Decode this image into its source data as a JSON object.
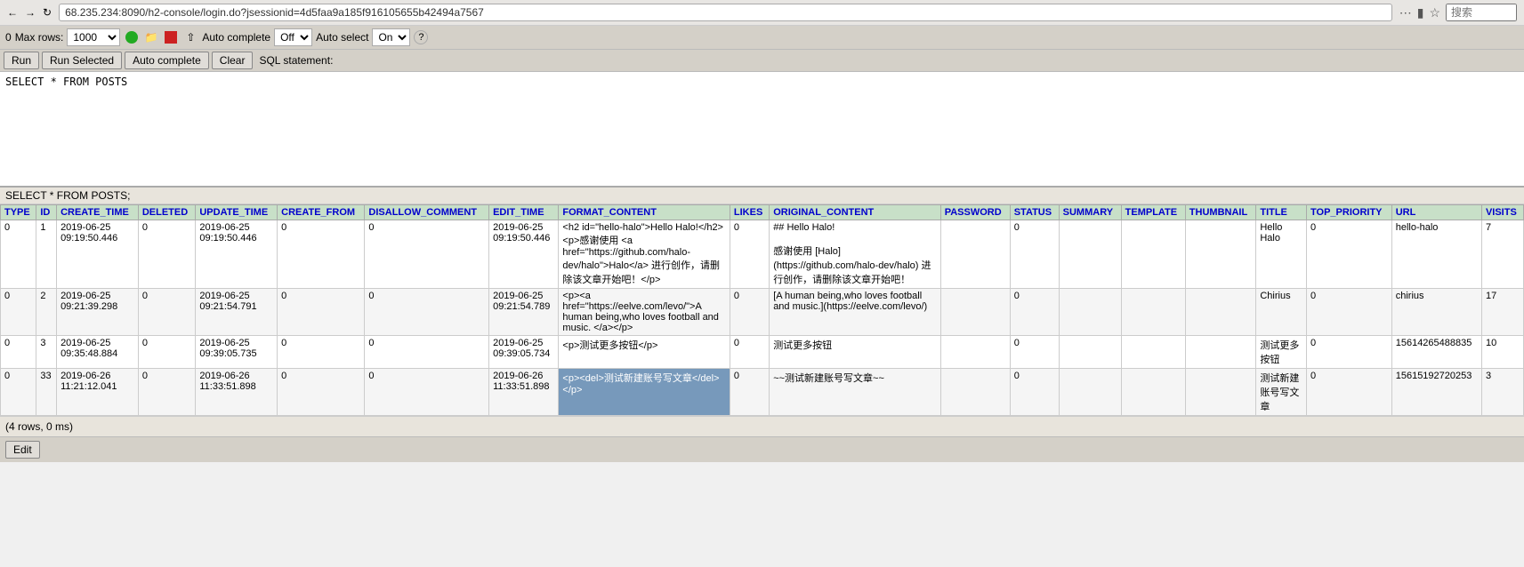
{
  "browser": {
    "url": "68.235.234:8090/h2-console/login.do?jsessionid=4d5faa9a185f916105655b42494a7567",
    "search_placeholder": "搜索"
  },
  "toolbar": {
    "max_rows_label": "Max rows:",
    "max_rows_value": "1000",
    "auto_complete_label": "Auto complete",
    "auto_complete_value": "Off",
    "auto_select_label": "Auto select",
    "auto_select_value": "On"
  },
  "buttons": {
    "run": "Run",
    "run_selected": "Run Selected",
    "auto_complete": "Auto complete",
    "clear": "Clear",
    "sql_statement": "SQL statement:",
    "edit": "Edit"
  },
  "sql_text": "SELECT * FROM POSTS",
  "query_history": "SELECT * FROM POSTS;",
  "row_info": "(4 rows, 0 ms)",
  "columns": [
    "TYPE",
    "ID",
    "CREATE_TIME",
    "DELETED",
    "UPDATE_TIME",
    "CREATE_FROM",
    "DISALLOW_COMMENT",
    "EDIT_TIME",
    "FORMAT_CONTENT",
    "LIKES",
    "ORIGINAL_CONTENT",
    "PASSWORD",
    "STATUS",
    "SUMMARY",
    "TEMPLATE",
    "THUMBNAIL",
    "TITLE",
    "TOP_PRIORITY",
    "URL",
    "VISITS"
  ],
  "rows": [
    {
      "TYPE": "0",
      "ID": "1",
      "CREATE_TIME": "2019-06-25\n09:19:50.446",
      "DELETED": "0",
      "UPDATE_TIME": "2019-06-25\n09:19:50.446",
      "CREATE_FROM": "0",
      "DISALLOW_COMMENT": "0",
      "EDIT_TIME": "2019-06-25\n09:19:50.446",
      "FORMAT_CONTENT": "<h2 id=\"hello-halo\">Hello Halo!</h2>\n<p>感谢使用 <a href=\"https://github.com/halo-dev/halo\">Halo</a> 进行创作，请删除该文章开始吧！</p>",
      "LIKES": "0",
      "ORIGINAL_CONTENT": "## Hello Halo!\n\n感谢使用 [Halo](https://github.com/halo-dev/halo) 进行创作，请删除该文章开始吧！",
      "PASSWORD": "",
      "STATUS": "0",
      "SUMMARY": "",
      "TEMPLATE": "",
      "THUMBNAIL": "",
      "TITLE": "Hello\nHalo",
      "TOP_PRIORITY": "0",
      "URL": "hello-halo",
      "VISITS": "7"
    },
    {
      "TYPE": "0",
      "ID": "2",
      "CREATE_TIME": "2019-06-25\n09:21:39.298",
      "DELETED": "0",
      "UPDATE_TIME": "2019-06-25\n09:21:54.791",
      "CREATE_FROM": "0",
      "DISALLOW_COMMENT": "0",
      "EDIT_TIME": "2019-06-25\n09:21:54.789",
      "FORMAT_CONTENT": "<p><a href=\"https://eelve.com/levo/\">A human being,who loves football and music. </a></p>",
      "LIKES": "0",
      "ORIGINAL_CONTENT": "[A human being,who loves football and music.](https://eelve.com/levo/)",
      "PASSWORD": "",
      "STATUS": "0",
      "SUMMARY": "",
      "TEMPLATE": "",
      "THUMBNAIL": "",
      "TITLE": "Chirius",
      "TOP_PRIORITY": "0",
      "URL": "chirius",
      "VISITS": "17"
    },
    {
      "TYPE": "0",
      "ID": "3",
      "CREATE_TIME": "2019-06-25\n09:35:48.884",
      "DELETED": "0",
      "UPDATE_TIME": "2019-06-25\n09:39:05.735",
      "CREATE_FROM": "0",
      "DISALLOW_COMMENT": "0",
      "EDIT_TIME": "2019-06-25\n09:39:05.734",
      "FORMAT_CONTENT": "<p>测试更多按钮</p>",
      "LIKES": "0",
      "ORIGINAL_CONTENT": "测试更多按钮",
      "PASSWORD": "",
      "STATUS": "0",
      "SUMMARY": "",
      "TEMPLATE": "",
      "THUMBNAIL": "",
      "TITLE": "测试更多\n按钮",
      "TOP_PRIORITY": "0",
      "URL": "15614265488835",
      "VISITS": "10"
    },
    {
      "TYPE": "0",
      "ID": "33",
      "CREATE_TIME": "2019-06-26\n11:21:12.041",
      "DELETED": "0",
      "UPDATE_TIME": "2019-06-26\n11:33:51.898",
      "CREATE_FROM": "0",
      "DISALLOW_COMMENT": "0",
      "EDIT_TIME": "2019-06-26\n11:33:51.898",
      "FORMAT_CONTENT": "<p><del>测试新建账号写文章</del></p>",
      "FORMAT_CONTENT_HIGHLIGHT": true,
      "LIKES": "0",
      "ORIGINAL_CONTENT": "~~测试新建账号写文章~~",
      "PASSWORD": "",
      "STATUS": "0",
      "SUMMARY": "",
      "TEMPLATE": "",
      "THUMBNAIL": "",
      "TITLE": "测试新建\n账号写文\n章",
      "TOP_PRIORITY": "0",
      "URL": "15615192720253",
      "VISITS": "3"
    }
  ]
}
